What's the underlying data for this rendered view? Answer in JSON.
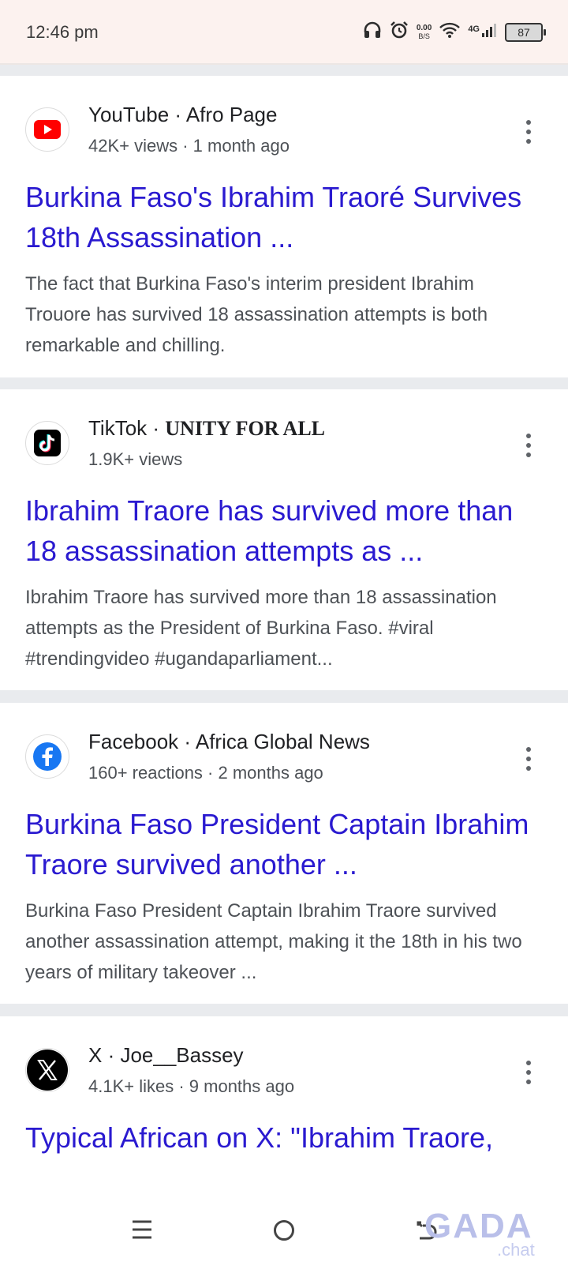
{
  "status_bar": {
    "time": "12:46 pm",
    "net_speed_value": "0.00",
    "net_speed_unit": "B/S",
    "network": "4G",
    "battery": "87"
  },
  "results": [
    {
      "source": "YouTube",
      "separator": " · ",
      "author": "Afro Page",
      "meta": "42K+ views · 1 month ago",
      "title": "Burkina Faso's Ibrahim Traoré Survives 18th Assassination ...",
      "snippet": "The fact that Burkina Faso's interim president Ibrahim Trouore has survived 18 assassination attempts is both remarkable and chilling.",
      "icon": "youtube-icon"
    },
    {
      "source": "TikTok",
      "separator": " · ",
      "author": "UNITY FOR ALL",
      "meta": "1.9K+ views",
      "title": "Ibrahim Traore has survived more than 18 assassination attempts as ...",
      "snippet": "Ibrahim Traore has survived more than 18 assassination attempts as the President of Burkina Faso. #viral #trendingvideo #ugandaparliament...",
      "icon": "tiktok-icon"
    },
    {
      "source": "Facebook",
      "separator": " · ",
      "author": "Africa Global News",
      "meta": "160+ reactions · 2 months ago",
      "title": "Burkina Faso President Captain Ibrahim Traore survived another ...",
      "snippet": "Burkina Faso President Captain Ibrahim Traore survived another assassination attempt, making it the 18th in his two years of military takeover ...",
      "icon": "facebook-icon"
    },
    {
      "source": "X",
      "separator": " · ",
      "author": "Joe__Bassey",
      "meta": "4.1K+ likes · 9 months ago",
      "title": "Typical African on X: \"Ibrahim Traore,",
      "icon": "x-icon"
    }
  ],
  "watermark": {
    "main": "GADA",
    "sub": ".chat"
  }
}
